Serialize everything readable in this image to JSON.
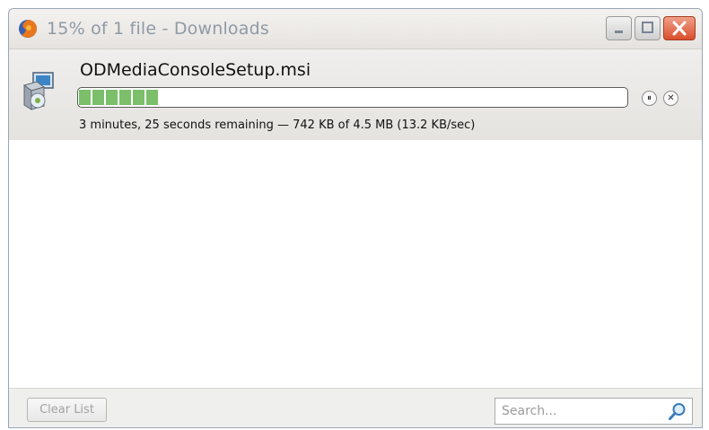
{
  "window": {
    "title": "15% of 1 file - Downloads"
  },
  "download": {
    "file_name": "ODMediaConsoleSetup.msi",
    "progress_percent": 15,
    "status": "3 minutes, 25 seconds remaining — 742 KB of 4.5 MB (13.2 KB/sec)",
    "pause_glyph": "⏸",
    "cancel_glyph": "✕",
    "progress_color": "#7bbf6a"
  },
  "footer": {
    "clear_label": "Clear List",
    "search_placeholder": "Search..."
  },
  "icons": {
    "app": "firefox-icon",
    "file": "installer-package-icon",
    "search": "magnifier-icon",
    "minimize": "minimize-icon",
    "maximize": "maximize-icon",
    "close": "close-icon"
  }
}
